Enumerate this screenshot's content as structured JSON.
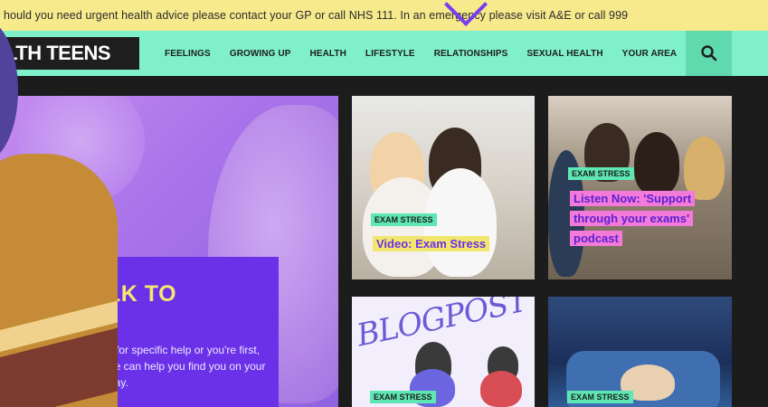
{
  "banner": {
    "text": "hould you need urgent health advice please contact your GP or call NHS 111. In an emergency please visit A&E or call 999"
  },
  "header": {
    "logo_text": "LTH TEENS",
    "nav_items": [
      "FEELINGS",
      "GROWING UP",
      "HEALTH",
      "LIFESTYLE",
      "RELATIONSHIPS",
      "SEXUAL HEALTH",
      "YOUR AREA"
    ],
    "search_icon": "search-icon"
  },
  "hero": {
    "title": "LK TO",
    "text": "g for specific help or you're first, we can help you find you on your way."
  },
  "tiles": [
    {
      "badge": "EXAM STRESS",
      "caption_lines": [
        "Video: Exam Stress"
      ]
    },
    {
      "badge": "EXAM STRESS",
      "caption_lines": [
        "Listen Now: 'Support",
        "through your exams'",
        "podcast"
      ]
    },
    {
      "badge": "EXAM STRESS",
      "image_text": "BLOGPOST"
    },
    {
      "badge": "EXAM STRESS"
    }
  ],
  "colors": {
    "banner": "#f6ea8c",
    "nav": "#7ff0c9",
    "accent_purple": "#6a31e8",
    "accent_yellow": "#f2e66c",
    "accent_pink": "#f47ad9",
    "badge": "#5ee7b5"
  }
}
